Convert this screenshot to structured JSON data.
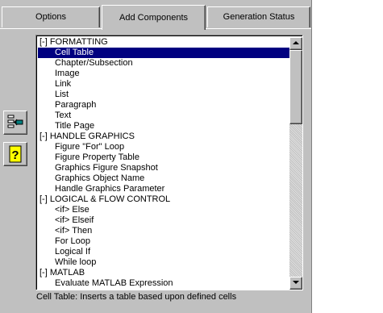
{
  "tabs": [
    {
      "label": "Options"
    },
    {
      "label": "Add Components"
    },
    {
      "label": "Generation Status"
    }
  ],
  "side_buttons": [
    {
      "icon": "add-component-icon"
    },
    {
      "icon": "help-icon",
      "glyph": "?"
    }
  ],
  "component_list": {
    "items": [
      {
        "text": "[-] FORMATTING",
        "kind": "section"
      },
      {
        "text": "Cell Table",
        "kind": "child",
        "selected": true
      },
      {
        "text": "Chapter/Subsection",
        "kind": "child"
      },
      {
        "text": "Image",
        "kind": "child"
      },
      {
        "text": "Link",
        "kind": "child"
      },
      {
        "text": "List",
        "kind": "child"
      },
      {
        "text": "Paragraph",
        "kind": "child"
      },
      {
        "text": "Text",
        "kind": "child"
      },
      {
        "text": "Title Page",
        "kind": "child"
      },
      {
        "text": "[-] HANDLE GRAPHICS",
        "kind": "section"
      },
      {
        "text": "Figure \"For\" Loop",
        "kind": "child"
      },
      {
        "text": "Figure Property Table",
        "kind": "child"
      },
      {
        "text": "Graphics Figure Snapshot",
        "kind": "child"
      },
      {
        "text": "Graphics Object Name",
        "kind": "child"
      },
      {
        "text": "Handle Graphics Parameter",
        "kind": "child"
      },
      {
        "text": "[-] LOGICAL & FLOW CONTROL",
        "kind": "section"
      },
      {
        "text": "<if> Else",
        "kind": "child"
      },
      {
        "text": "<if> Elseif",
        "kind": "child"
      },
      {
        "text": "<if> Then",
        "kind": "child"
      },
      {
        "text": "For Loop",
        "kind": "child"
      },
      {
        "text": "Logical If",
        "kind": "child"
      },
      {
        "text": "While loop",
        "kind": "child"
      },
      {
        "text": "[-] MATLAB",
        "kind": "section"
      },
      {
        "text": "Evaluate MATLAB Expression",
        "kind": "child"
      }
    ]
  },
  "status_text": "Cell Table: Inserts a table based upon defined cells",
  "colors": {
    "panel": "#c0c0c0",
    "selection": "#000080",
    "help_icon": "#ffff00"
  }
}
